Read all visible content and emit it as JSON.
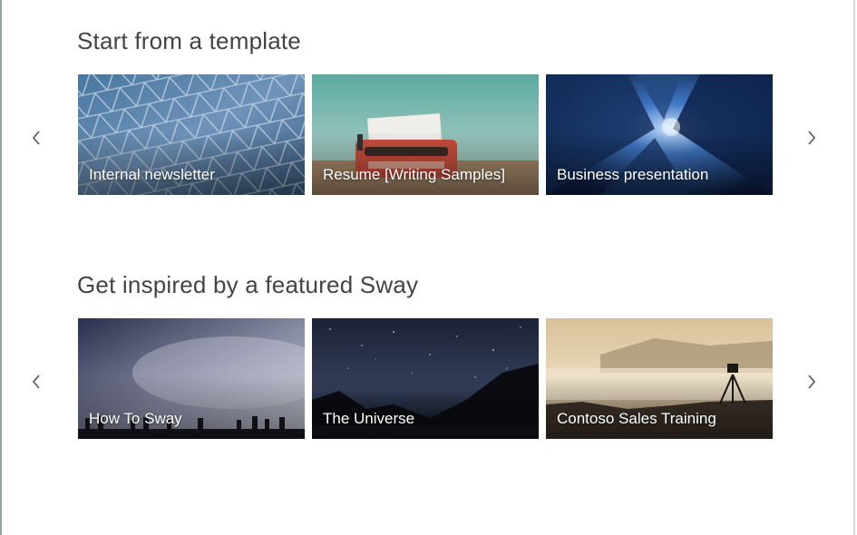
{
  "sections": [
    {
      "title": "Start from a template",
      "cards": [
        {
          "label": "Internal newsletter",
          "image": "glass-triangle-roof"
        },
        {
          "label": "Resume [Writing Samples]",
          "image": "red-typewriter"
        },
        {
          "label": "Business presentation",
          "image": "skyscrapers-looking-up"
        }
      ]
    },
    {
      "title": "Get inspired by a featured Sway",
      "cards": [
        {
          "label": "How To Sway",
          "image": "people-under-night-sky"
        },
        {
          "label": "The Universe",
          "image": "starry-night-mountains"
        },
        {
          "label": "Contoso Sales Training",
          "image": "camera-tripod-foggy-valley"
        }
      ]
    }
  ],
  "colors": {
    "heading": "#444444",
    "arrow": "#555555",
    "background": "#ffffff"
  }
}
